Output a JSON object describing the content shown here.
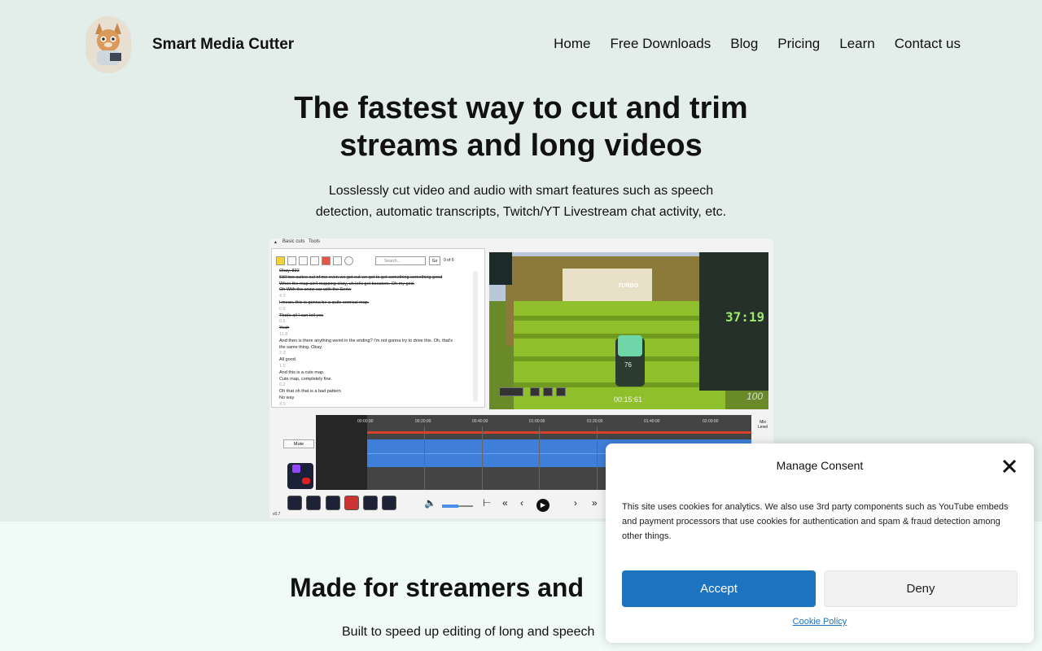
{
  "header": {
    "brand": "Smart Media Cutter",
    "logo_icon": "lynx-mascot-icon",
    "nav": [
      "Home",
      "Free Downloads",
      "Blog",
      "Pricing",
      "Learn",
      "Contact us"
    ]
  },
  "hero": {
    "title_line1": "The fastest way to cut and trim",
    "title_line2": "streams and long videos",
    "subtitle_line1": "Losslessly cut video and audio with smart features such as speech",
    "subtitle_line2": "detection, automatic transcripts, Twitch/YT Livestream chat activity, etc."
  },
  "app_screenshot": {
    "menu": [
      "Basic cuts",
      "Tools"
    ],
    "search_placeholder": "Search...",
    "go_label": "Go",
    "match_count": "0 of 0",
    "transcript_lines": [
      {
        "text": "Okay, 832",
        "style": "struck"
      },
      {
        "text": "Still two suites out of me even we got out we got to get something something good",
        "style": "struck"
      },
      {
        "text": "When the map ain't mapping okay, uh let's get boosters. Oh my god.",
        "style": "struck"
      },
      {
        "text": "Oh With the snow car with the Snow",
        "style": "struck"
      },
      {
        "text": "4.2",
        "style": "ts"
      },
      {
        "text": "I mean, this is gonna be a quite comical map.",
        "style": "struck"
      },
      {
        "text": "0.6",
        "style": "ts"
      },
      {
        "text": "That's all I can tell you",
        "style": "struck"
      },
      {
        "text": "0.6",
        "style": "ts"
      },
      {
        "text": "Yeah",
        "style": "struck"
      },
      {
        "text": "11.8",
        "style": "ts"
      },
      {
        "text": "And then is there anything weird in the ending? I'm not gonna try to drive this. Oh, that's",
        "style": "plain"
      },
      {
        "text": "the same thing. Okay.",
        "style": "plain"
      },
      {
        "text": "2.3",
        "style": "ts"
      },
      {
        "text": "All good",
        "style": "plain"
      },
      {
        "text": "1.5",
        "style": "ts"
      },
      {
        "text": "And this is a cute map.",
        "style": "plain"
      },
      {
        "text": "Cute map, completely fine.",
        "style": "plain"
      },
      {
        "text": "0.2",
        "style": "ts"
      },
      {
        "text": "Oh that oh that is a bad pattern",
        "style": "plain"
      },
      {
        "text": "No way",
        "style": "plain"
      },
      {
        "text": "3.0",
        "style": "ts"
      }
    ],
    "video": {
      "timer": "37:19",
      "clock": "00:15:61",
      "score": "100",
      "turbo": "TURBO",
      "car_number": "76"
    },
    "mute_label": "Mute",
    "timeline_ticks": [
      "00:00:00",
      "00:20:00",
      "00:40:00",
      "01:00:00",
      "01:20:00",
      "01:40:00",
      "02:00:00"
    ],
    "mix_level": "Mix Level",
    "version": "v0.7"
  },
  "section2": {
    "title": "Made for streamers and",
    "subtitle": "Built to speed up editing of long and speech"
  },
  "consent": {
    "title": "Manage Consent",
    "body": "This site uses cookies for analytics. We also use 3rd party components such as YouTube embeds and payment processors that use cookies for authentication and spam & fraud detection among other things.",
    "accept": "Accept",
    "deny": "Deny",
    "policy": "Cookie Policy"
  },
  "colors": {
    "hero_bg": "#e3edea",
    "page_bg": "#f0fbf8",
    "accept_blue": "#1e73be",
    "timeline_red": "#d7412b",
    "waveform_blue": "#3f7fd9"
  }
}
